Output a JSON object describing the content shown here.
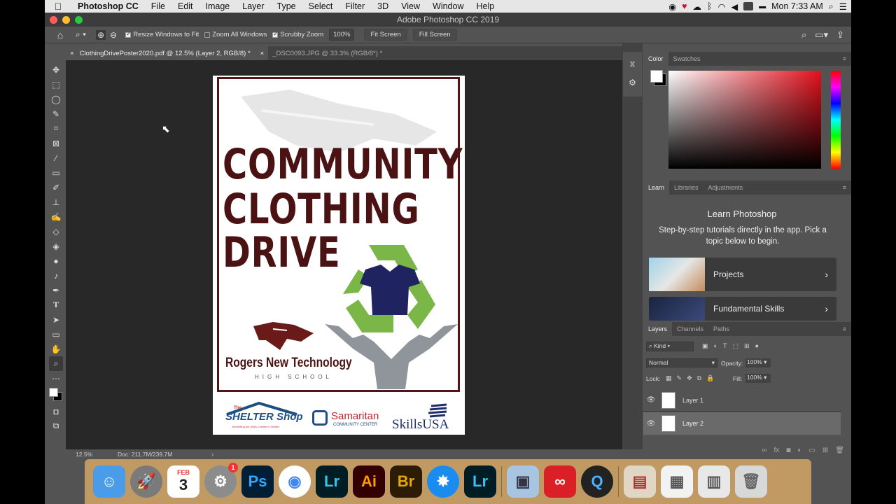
{
  "menubar": {
    "app": "Photoshop CC",
    "items": [
      "File",
      "Edit",
      "Image",
      "Layer",
      "Type",
      "Select",
      "Filter",
      "3D",
      "View",
      "Window",
      "Help"
    ],
    "clock": "Mon 7:33 AM"
  },
  "window": {
    "title": "Adobe Photoshop CC 2019"
  },
  "options": {
    "resize_label": "Resize Windows to Fit",
    "zoom_all_label": "Zoom All Windows",
    "scrubby_label": "Scrubby Zoom",
    "zoom_value": "100%",
    "fit_screen": "Fit Screen",
    "fill_screen": "Fill Screen"
  },
  "tabs": [
    {
      "label": "ClothingDrivePoster2020.pdf @ 12.5% (Layer 2, RGB/8) *"
    },
    {
      "label": "_DSC0093.JPG @ 33.3% (RGB/8*) *"
    }
  ],
  "poster": {
    "line1": "COMMUNITY",
    "line2": "CLOTHING",
    "line3": "DRIVE",
    "school_name": "Rogers New Technology",
    "school_sub": "HIGH SCHOOL",
    "sponsor1_top": "The",
    "sponsor1_main": "SHELTER Shop",
    "sponsor1_sub": "Benefiting the NWA Children's Shelter",
    "sponsor2_main": "Samaritan",
    "sponsor2_sub": "COMMUNITY CENTER",
    "sponsor3": "SkillsUSA"
  },
  "status": {
    "zoom": "12.5%",
    "doc": "Doc: 211.7M/239.7M"
  },
  "color_panel": {
    "tab_color": "Color",
    "tab_swatches": "Swatches"
  },
  "learn_panel": {
    "tabs": [
      "Learn",
      "Libraries",
      "Adjustments"
    ],
    "title": "Learn Photoshop",
    "desc": "Step-by-step tutorials directly in the app. Pick a topic below to begin.",
    "cards": [
      "Projects",
      "Fundamental Skills"
    ]
  },
  "layers_panel": {
    "tabs": [
      "Layers",
      "Channels",
      "Paths"
    ],
    "kind": "Kind",
    "blend": "Normal",
    "opacity_label": "Opacity:",
    "opacity": "100%",
    "lock_label": "Lock:",
    "fill_label": "Fill:",
    "fill": "100%",
    "layers": [
      "Layer 1",
      "Layer 2"
    ]
  },
  "dock": {
    "calendar_month": "FEB",
    "calendar_day": "3",
    "badge": "1",
    "apps": [
      "Ps",
      "Lr",
      "Ai",
      "Br",
      "Lr"
    ]
  },
  "colors": {
    "poster_maroon": "#4a1212",
    "recycle_green": "#7ab648",
    "shirt_navy": "#1f2460",
    "hands_gray": "#8f959a"
  }
}
